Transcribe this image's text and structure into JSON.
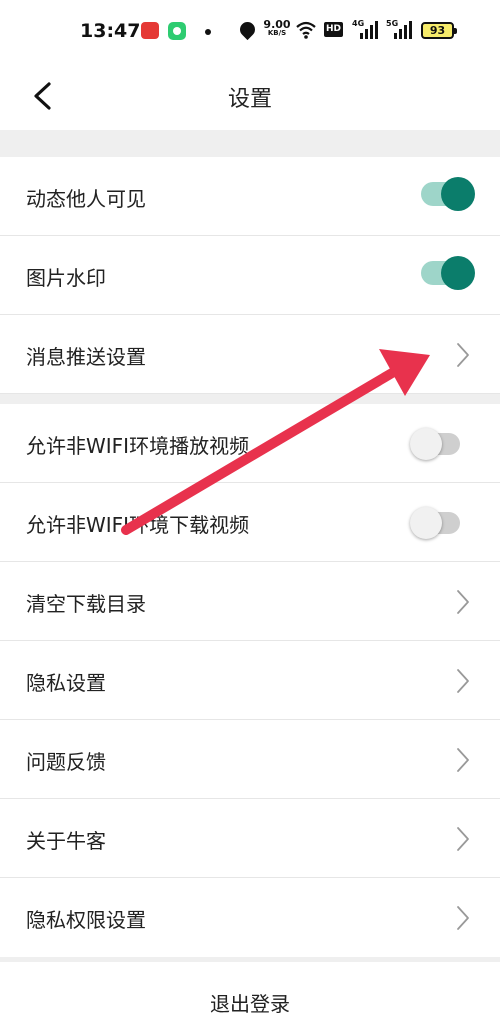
{
  "status_bar": {
    "time": "13:47",
    "net_speed_value": "9.00",
    "net_speed_unit": "KB/S",
    "hd_label": "HD",
    "signal1_label": "4G",
    "signal2_label": "5G",
    "battery": "93"
  },
  "header": {
    "title": "设置"
  },
  "rows": [
    {
      "label": "动态他人可见",
      "control": "toggle",
      "on": true
    },
    {
      "label": "图片水印",
      "control": "toggle",
      "on": true
    },
    {
      "label": "消息推送设置",
      "control": "chevron"
    },
    {
      "label": "允许非WIFI环境播放视频",
      "control": "toggle",
      "on": false
    },
    {
      "label": "允许非WIFI环境下载视频",
      "control": "toggle",
      "on": false
    },
    {
      "label": "清空下载目录",
      "control": "chevron"
    },
    {
      "label": "隐私设置",
      "control": "chevron"
    },
    {
      "label": "问题反馈",
      "control": "chevron"
    },
    {
      "label": "关于牛客",
      "control": "chevron"
    },
    {
      "label": "隐私权限设置",
      "control": "chevron"
    }
  ],
  "footer": {
    "logout_label": "退出登录"
  },
  "colors": {
    "toggle_on_thumb": "#0b7d6b",
    "toggle_on_track": "#9ed5c9",
    "toggle_off_track": "#cfcfcf",
    "annotation_arrow": "#e8324d",
    "section_gap": "#efefef"
  },
  "icons": {
    "back": "chevron-left-icon",
    "row_arrow": "chevron-right-icon"
  }
}
